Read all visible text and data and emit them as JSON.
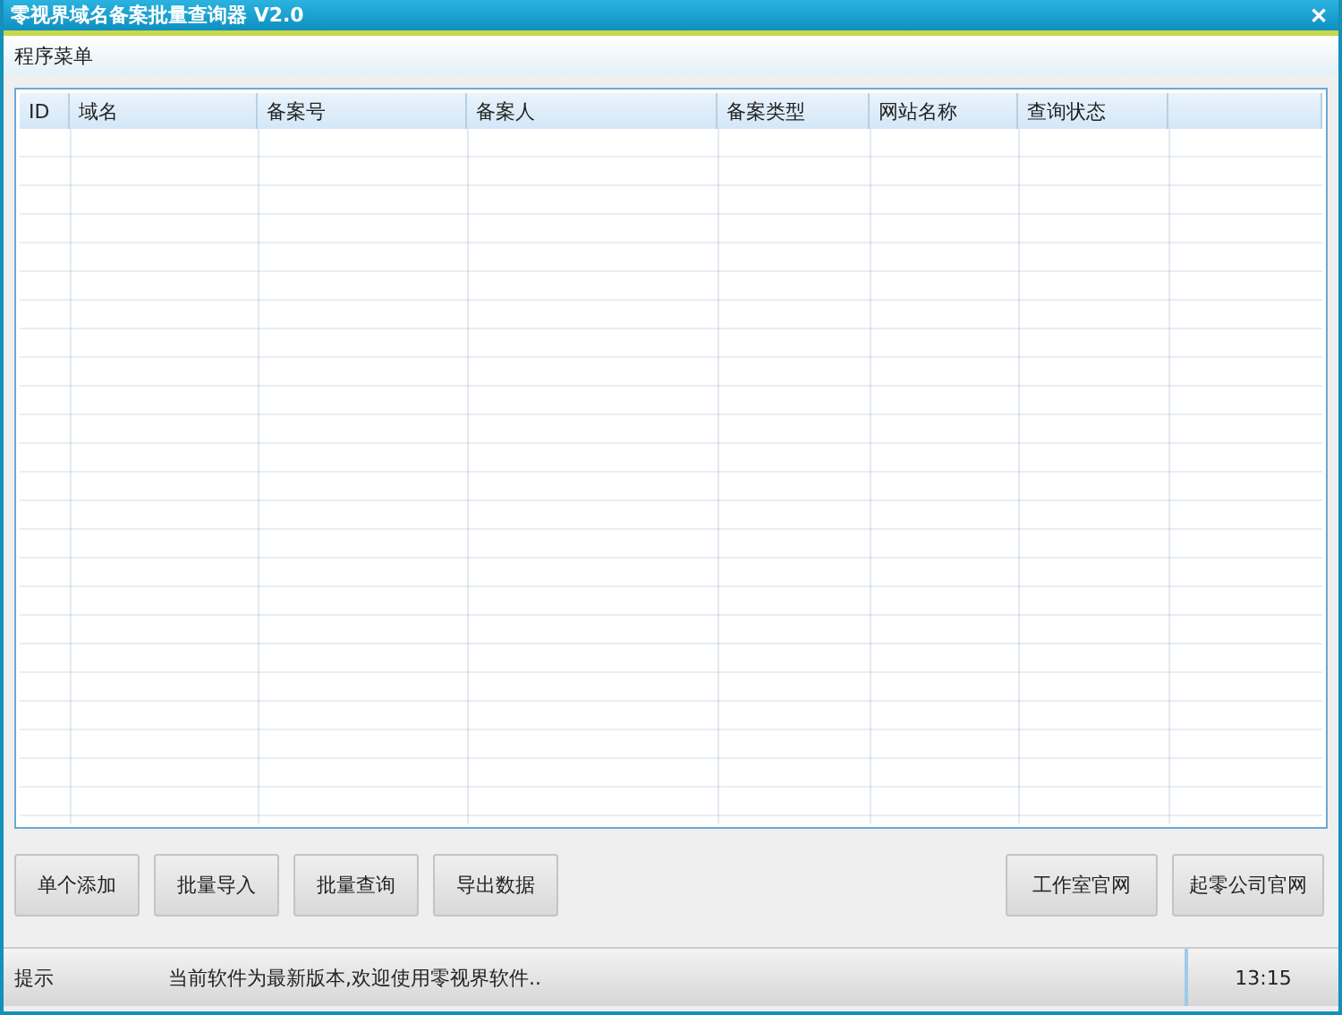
{
  "window": {
    "title": "零视界域名备案批量查询器 V2.0",
    "close": "✕"
  },
  "menu": {
    "label": "程序菜单"
  },
  "table": {
    "columns": [
      "ID",
      "域名",
      "备案号",
      "备案人",
      "备案类型",
      "网站名称",
      "查询状态"
    ]
  },
  "buttons_left": [
    "单个添加",
    "批量导入",
    "批量查询",
    "导出数据"
  ],
  "buttons_right": [
    "工作室官网",
    "起零公司官网"
  ],
  "status_bar": {
    "label": "提示",
    "message": "当前软件为最新版本,欢迎使用零视界软件..",
    "time": "13:15"
  }
}
